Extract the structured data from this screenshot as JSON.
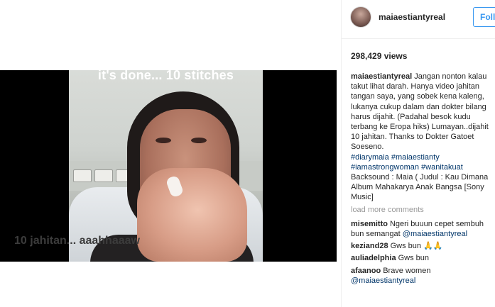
{
  "post": {
    "video_overlay_text": "it's done... 10 stitches",
    "video_subtitle": "10 jahitan... aaahhaaaw"
  },
  "header": {
    "username": "maiaestiantyreal",
    "follow_label": "Follo"
  },
  "views": "298,429 views",
  "caption": {
    "username": "maiaestiantyreal",
    "lines": [
      "Jangan nonton kalau",
      "takut lihat darah. Hanya video jahitan",
      "tangan saya, yang sobek kena kaleng,",
      "lukanya cukup dalam dan dokter bilang",
      "harus dijahit. (Padahal besok kudu",
      "terbang ke Eropa hiks) Lumayan..dijahit",
      "10 jahitan. Thanks to Dokter Gatoet",
      "Soeseno."
    ],
    "hashtags_line1": "#diarymaia #maiaestianty",
    "hashtags_line2": "#iamastrongwoman #wanitakuat",
    "backsound_lines": [
      "Backsound : Maia ( Judul : Kau Dimana",
      "Album Mahakarya Anak Bangsa [Sony",
      "Music]"
    ]
  },
  "load_more": "load more comments",
  "comments": [
    {
      "user": "misemitto",
      "text": "Ngeri buuun cepet sembuh",
      "text2": "bun semangat ",
      "mention": "@maiaestiantyreal"
    },
    {
      "user": "keziand28",
      "text": "Gws bun 🙏🙏"
    },
    {
      "user": "auliadelphia",
      "text": "Gws bun"
    },
    {
      "user": "afaanoo",
      "text": "Brave women",
      "mention": "@maiaestiantyreal"
    }
  ],
  "colors": {
    "accent": "#3897f0",
    "link": "#003569",
    "muted": "#999999"
  }
}
